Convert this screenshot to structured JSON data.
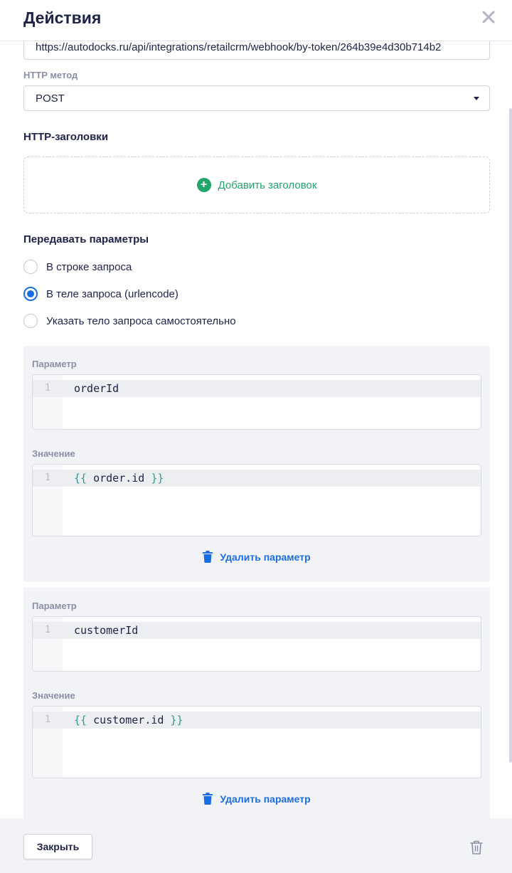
{
  "header": {
    "title": "Действия"
  },
  "form": {
    "url_value": "https://autodocks.ru/api/integrations/retailcrm/webhook/by-token/264b39e4d30b714b2",
    "method_label": "HTTP метод",
    "method_value": "POST",
    "headers_title": "HTTP-заголовки",
    "add_header_label": "Добавить заголовок",
    "params_title": "Передавать параметры",
    "radio_options": [
      {
        "label": "В строке запроса",
        "checked": false
      },
      {
        "label": "В теле запроса (urlencode)",
        "checked": true
      },
      {
        "label": "Указать тело запроса самостоятельно",
        "checked": false
      }
    ]
  },
  "params": [
    {
      "param_label": "Параметр",
      "param_line": "1",
      "param_code": "orderId",
      "value_label": "Значение",
      "value_line": "1",
      "value_open": "{{",
      "value_expr": " order.id ",
      "value_close": "}}",
      "delete_label": "Удалить параметр"
    },
    {
      "param_label": "Параметр",
      "param_line": "1",
      "param_code": "customerId",
      "value_label": "Значение",
      "value_line": "1",
      "value_open": "{{",
      "value_expr": " customer.id ",
      "value_close": "}}",
      "delete_label": "Удалить параметр"
    }
  ],
  "footer": {
    "close_label": "Закрыть"
  },
  "icons": {
    "close": "close-icon",
    "add": "plus-circle-icon",
    "delete": "trash-icon"
  },
  "colors": {
    "accent_blue": "#1a6de2",
    "accent_green": "#22a46b",
    "text": "#1e2248",
    "muted": "#8a8fa7"
  }
}
